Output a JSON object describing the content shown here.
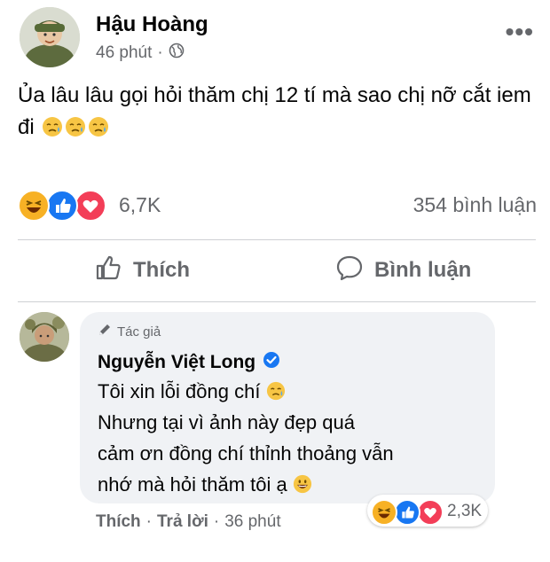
{
  "post": {
    "author": "Hậu Hoàng",
    "time": "46 phút",
    "separator": "·",
    "text": "Ủa lâu lâu gọi hỏi thăm chị 12 tí mà sao chị nỡ cắt iem đi",
    "emoji_icons": [
      "crying-face-emoji",
      "crying-face-emoji",
      "crying-face-emoji"
    ],
    "reaction_icons": [
      "haha-reaction",
      "like-reaction",
      "love-reaction"
    ],
    "reaction_count": "6,7K",
    "comment_count": "354 bình luận"
  },
  "actions": {
    "like_label": "Thích",
    "comment_label": "Bình luận"
  },
  "comment": {
    "badge": "Tác giả",
    "author": "Nguyễn Việt Long",
    "verified": true,
    "lines": [
      "Tôi xin lỗi đồng chí",
      "Nhưng tại vì ảnh này đẹp quá",
      "cảm ơn đồng chí thỉnh thoảng vẫn",
      "nhớ mà hỏi thăm tôi ạ"
    ],
    "reaction_icons": [
      "haha-reaction",
      "like-reaction",
      "love-reaction"
    ],
    "reaction_count": "2,3K",
    "footer": {
      "like": "Thích",
      "dot": "·",
      "reply": "Trả lời",
      "time": "36 phút"
    }
  },
  "colors": {
    "text_primary": "#050505",
    "text_secondary": "#65676b",
    "bubble_bg": "#f0f2f5",
    "like_blue": "#1877f2",
    "love_red": "#f33e58",
    "haha_yellow": "#f7b125",
    "verified_blue": "#1877f2"
  }
}
